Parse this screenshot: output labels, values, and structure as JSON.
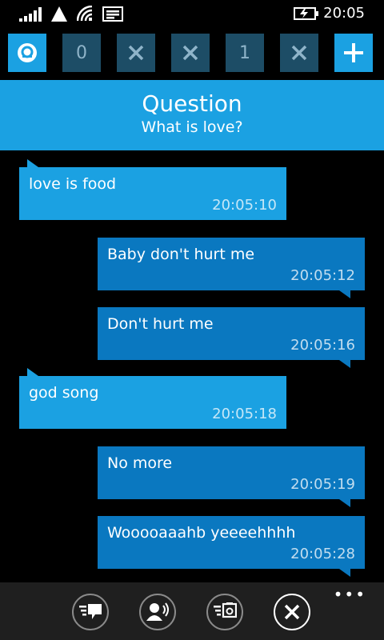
{
  "status_bar": {
    "time": "20:05",
    "icons": [
      "signal-icon",
      "data-icon",
      "wifi-icon",
      "message-icon",
      "battery-charging-icon"
    ]
  },
  "tabs": [
    {
      "type": "app",
      "icon": "logo-icon"
    },
    {
      "type": "count",
      "label": "0"
    },
    {
      "type": "close",
      "icon": "close-icon"
    },
    {
      "type": "close",
      "icon": "close-icon"
    },
    {
      "type": "count",
      "label": "1"
    },
    {
      "type": "close",
      "icon": "close-icon"
    },
    {
      "type": "add",
      "icon": "plus-icon"
    }
  ],
  "question": {
    "title": "Question",
    "subtitle": "What is love?"
  },
  "messages": [
    {
      "side": "left",
      "text": "love is food",
      "time": "20:05:10"
    },
    {
      "side": "right",
      "text": "Baby don't hurt me",
      "time": "20:05:12"
    },
    {
      "side": "right",
      "text": "Don't hurt me",
      "time": "20:05:16"
    },
    {
      "side": "left",
      "text": "god song",
      "time": "20:05:18"
    },
    {
      "side": "right",
      "text": "No more",
      "time": "20:05:19"
    },
    {
      "side": "right",
      "text": "Wooooaaahb yeeeehhhh",
      "time": "20:05:28"
    }
  ],
  "appbar": {
    "buttons": [
      "reply-icon",
      "voice-icon",
      "image-icon",
      "close-icon"
    ],
    "more": "•••"
  },
  "colors": {
    "accent": "#1ba1e2",
    "accent_dark": "#0a78c0",
    "tab_dim": "#1d4d66",
    "background": "#000000",
    "appbar": "#1f1f1f"
  }
}
